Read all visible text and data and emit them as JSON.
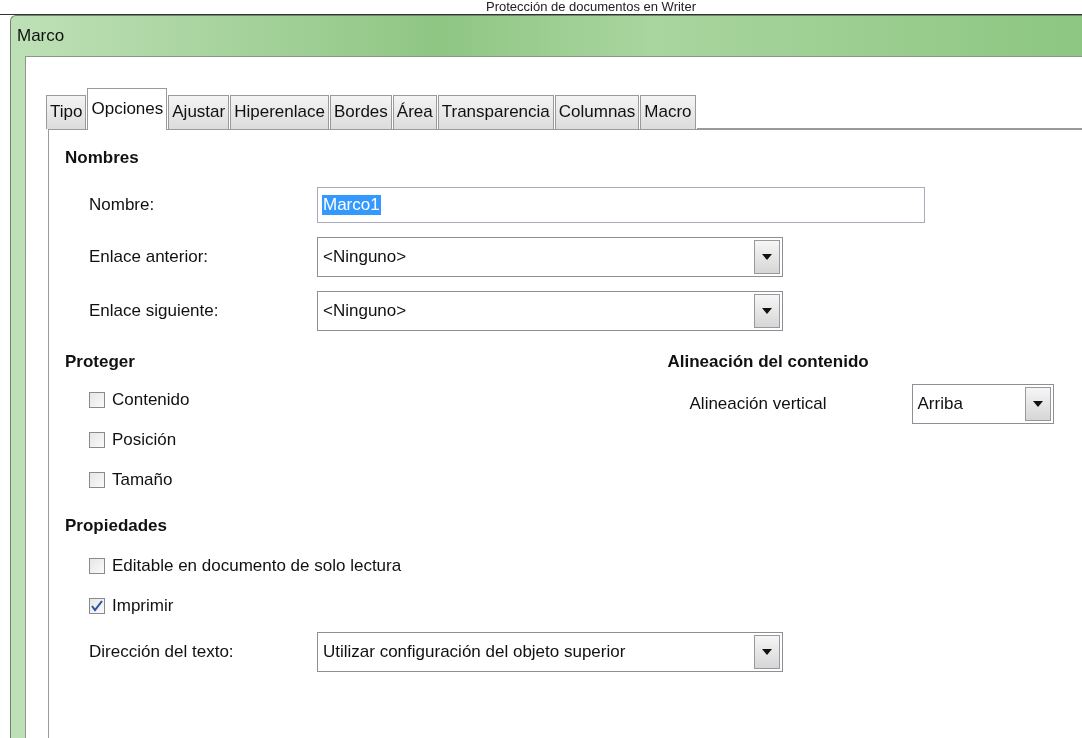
{
  "caption": "Protección de documentos en Writer",
  "window": {
    "title": "Marco"
  },
  "tabs": [
    {
      "label": "Tipo",
      "selected": false
    },
    {
      "label": "Opciones",
      "selected": true
    },
    {
      "label": "Ajustar",
      "selected": false
    },
    {
      "label": "Hiperenlace",
      "selected": false
    },
    {
      "label": "Bordes",
      "selected": false
    },
    {
      "label": "Área",
      "selected": false
    },
    {
      "label": "Transparencia",
      "selected": false
    },
    {
      "label": "Columnas",
      "selected": false
    },
    {
      "label": "Macro",
      "selected": false
    }
  ],
  "nombres": {
    "heading": "Nombres",
    "rows": [
      {
        "label": "Nombre:",
        "kind": "text",
        "value": "Marco1",
        "selected": true
      },
      {
        "label": "Enlace anterior:",
        "kind": "combo",
        "value": "<Ninguno>",
        "selected": false
      },
      {
        "label": "Enlace siguiente:",
        "kind": "combo",
        "value": "<Ninguno>",
        "selected": false
      }
    ]
  },
  "proteger": {
    "heading": "Proteger",
    "items": [
      {
        "label": "Contenido",
        "checked": false
      },
      {
        "label": "Posición",
        "checked": false
      },
      {
        "label": "Tamaño",
        "checked": false
      }
    ]
  },
  "alineacion": {
    "heading": "Alineación del contenido",
    "label": "Alineación vertical",
    "value": "Arriba"
  },
  "propiedades": {
    "heading": "Propiedades",
    "items": [
      {
        "label": "Editable en documento de solo lectura",
        "checked": false
      },
      {
        "label": "Imprimir",
        "checked": true
      }
    ],
    "direction": {
      "label": "Dirección del texto:",
      "value": "Utilizar configuración del objeto superior"
    }
  }
}
